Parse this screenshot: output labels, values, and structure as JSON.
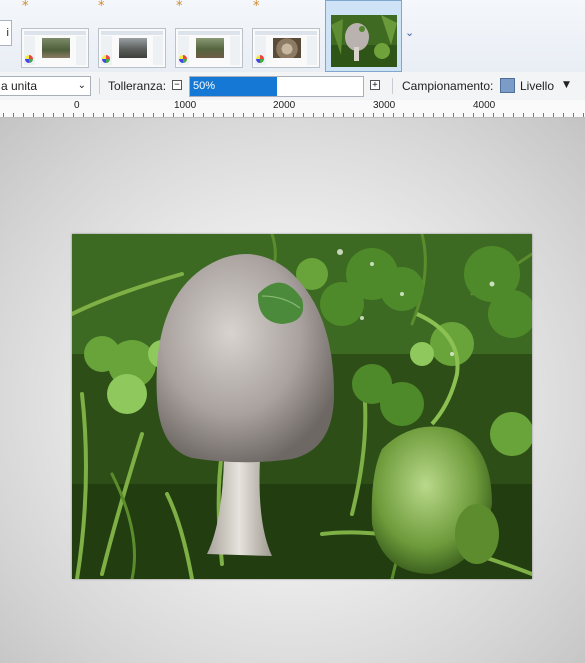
{
  "thumbnails": {
    "left_tab_label": "i",
    "modified_marker": "*",
    "overflow_icon": "chevron-down-icon",
    "items": [
      {
        "name": "thumb-1"
      },
      {
        "name": "thumb-2"
      },
      {
        "name": "thumb-3"
      },
      {
        "name": "thumb-4"
      },
      {
        "name": "thumb-active-mushroom"
      }
    ]
  },
  "toolbar": {
    "mode_value": "a unita",
    "tolerance_label": "Tolleranza:",
    "tolerance_value": "50%",
    "tolerance_fraction": 0.5,
    "minus_symbol": "−",
    "plus_symbol": "+",
    "sampling_label": "Campionamento:",
    "sampling_value": "Livello",
    "sampling_color": "#7a9cc6"
  },
  "ruler": {
    "labels": [
      "0",
      "1000",
      "2000",
      "3000",
      "4000"
    ]
  },
  "colors": {
    "accent": "#1478d4",
    "active_thumb_bg": "#cfe3f7"
  }
}
